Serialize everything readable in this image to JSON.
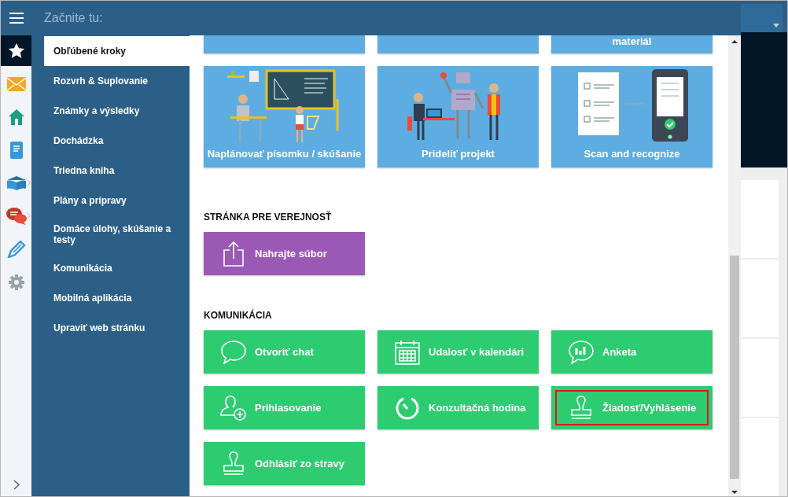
{
  "header": {
    "title": "Začnite tu:"
  },
  "rail": [
    {
      "kind": "star",
      "selected": true,
      "submenu": false
    },
    {
      "kind": "mail",
      "selected": false,
      "submenu": false
    },
    {
      "kind": "home",
      "selected": false,
      "submenu": false
    },
    {
      "kind": "notebook",
      "selected": false,
      "submenu": false
    },
    {
      "kind": "book",
      "selected": false,
      "submenu": true
    },
    {
      "kind": "chat",
      "selected": false,
      "submenu": true
    },
    {
      "kind": "pen",
      "selected": false,
      "submenu": false
    },
    {
      "kind": "gear",
      "selected": false,
      "submenu": false
    }
  ],
  "menu": [
    {
      "label": "Obľúbené kroky",
      "selected": true
    },
    {
      "label": "Rozvrh & Suplovanie",
      "selected": false
    },
    {
      "label": "Známky a výsledky",
      "selected": false
    },
    {
      "label": "Dochádzka",
      "selected": false
    },
    {
      "label": "Triedna kniha",
      "selected": false
    },
    {
      "label": "Plány a prípravy",
      "selected": false
    },
    {
      "label": "Domáce úlohy, skúšanie a testy",
      "selected": false
    },
    {
      "label": "Komunikácia",
      "selected": false
    },
    {
      "label": "Mobilná aplikácia",
      "selected": false
    },
    {
      "label": "Upraviť web stránku",
      "selected": false
    }
  ],
  "sections": [
    {
      "color": "#5dade2",
      "tiles": [
        {
          "kind": "cut",
          "highlighted": false
        },
        {
          "kind": "cut",
          "highlighted": false
        },
        {
          "kind": "cut",
          "label": "materiál",
          "highlighted": false
        },
        {
          "kind": "classroom",
          "label": "Naplánovať písomku / skúšanie",
          "highlighted": false
        },
        {
          "kind": "robot",
          "label": "Prideliť projekt",
          "highlighted": false
        },
        {
          "kind": "scan",
          "label": "Scan and recognize",
          "highlighted": false
        }
      ]
    },
    {
      "heading": "STRÁNKA PRE VEREJNOSŤ",
      "color": "#9b59b6",
      "tiles": [
        {
          "kind": "upload",
          "label": "Nahrajte súbor",
          "highlighted": false
        }
      ]
    },
    {
      "heading": "KOMUNIKÁCIA",
      "color": "#2ecc71",
      "tiles": [
        {
          "kind": "chat",
          "label": "Otvoriť chat",
          "highlighted": false
        },
        {
          "kind": "calendar",
          "label": "Udalosť v kalendári",
          "highlighted": false
        },
        {
          "kind": "poll",
          "label": "Anketa",
          "highlighted": false
        },
        {
          "kind": "user-add",
          "label": "Prihlasovanie",
          "highlighted": false
        },
        {
          "kind": "timer",
          "label": "Konzultačná hodina",
          "highlighted": false
        },
        {
          "kind": "stamp",
          "label": "Žiadosť/Vyhlásenie",
          "highlighted": true
        },
        {
          "kind": "stamp",
          "label": "Odhlásiť zo stravy",
          "highlighted": false
        }
      ]
    }
  ]
}
